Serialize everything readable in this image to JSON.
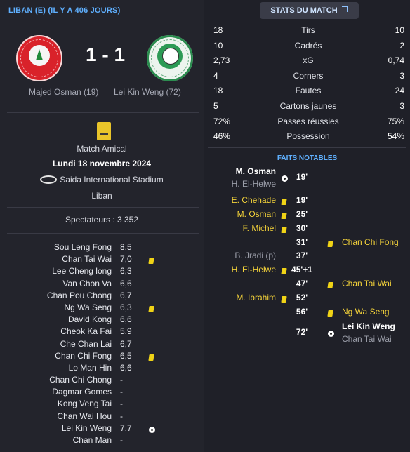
{
  "match": {
    "header": "LIBAN (E) (IL Y A 406 JOURS)",
    "score": "1 - 1",
    "home_scorer": "Majed Osman (19)",
    "away_scorer": "Lei Kin Weng (72)",
    "competition": "Match Amical",
    "date": "Lundi 18 novembre 2024",
    "stadium": "Saida International Stadium",
    "country": "Liban",
    "spectators": "Spectateurs : 3 352",
    "home_crest_text": "LEBANON F.A",
    "away_crest_icon": "football-association-crest",
    "competition_icon": "fifa-badge",
    "stadium_icon": "stadium-icon"
  },
  "players": [
    {
      "name": "Sou Leng Fong",
      "rating": "8,5",
      "icon": ""
    },
    {
      "name": "Chan Tai Wai",
      "rating": "7,0",
      "icon": "yellow-card"
    },
    {
      "name": "Lee Cheng long",
      "rating": "6,3",
      "icon": ""
    },
    {
      "name": "Van Chon Va",
      "rating": "6,6",
      "icon": ""
    },
    {
      "name": "Chan Pou Chong",
      "rating": "6,7",
      "icon": ""
    },
    {
      "name": "Ng Wa Seng",
      "rating": "6,3",
      "icon": "yellow-card"
    },
    {
      "name": "David Kong",
      "rating": "6,6",
      "icon": ""
    },
    {
      "name": "Cheok Ka Fai",
      "rating": "5,9",
      "icon": ""
    },
    {
      "name": "Che Chan Lai",
      "rating": "6,7",
      "icon": ""
    },
    {
      "name": "Chan Chi Fong",
      "rating": "6,5",
      "icon": "yellow-card"
    },
    {
      "name": "Lo Man Hin",
      "rating": "6,6",
      "icon": ""
    },
    {
      "name": "Chan Chi Chong",
      "rating": "-",
      "icon": ""
    },
    {
      "name": "Dagmar Gomes",
      "rating": "-",
      "icon": ""
    },
    {
      "name": "Kong Veng Tai",
      "rating": "-",
      "icon": ""
    },
    {
      "name": "Chan Wai Hou",
      "rating": "-",
      "icon": ""
    },
    {
      "name": "Lei Kin Weng",
      "rating": "7,7",
      "icon": "goal-ball"
    },
    {
      "name": "Chan Man",
      "rating": "-",
      "icon": ""
    }
  ],
  "stats": {
    "button_label": "STATS DU MATCH",
    "rows": [
      {
        "home": "18",
        "label": "Tirs",
        "away": "10"
      },
      {
        "home": "10",
        "label": "Cadrés",
        "away": "2"
      },
      {
        "home": "2,73",
        "label": "xG",
        "away": "0,74"
      },
      {
        "home": "4",
        "label": "Corners",
        "away": "3"
      },
      {
        "home": "18",
        "label": "Fautes",
        "away": "24"
      },
      {
        "home": "5",
        "label": "Cartons jaunes",
        "away": "3"
      },
      {
        "home": "72%",
        "label": "Passes réussies",
        "away": "75%"
      },
      {
        "home": "46%",
        "label": "Possession",
        "away": "54%"
      }
    ]
  },
  "events": {
    "title": "FAITS NOTABLES",
    "items": [
      {
        "side": "home",
        "primary": "M. Osman",
        "secondary": "H. El-Helwe",
        "minute": "19'",
        "icon": "goal-ball"
      },
      {
        "side": "home",
        "primary": "E. Chehade",
        "secondary": "",
        "minute": "19'",
        "icon": "yellow-card"
      },
      {
        "side": "home",
        "primary": "M. Osman",
        "secondary": "",
        "minute": "25'",
        "icon": "yellow-card"
      },
      {
        "side": "home",
        "primary": "F. Michel",
        "secondary": "",
        "minute": "30'",
        "icon": "yellow-card"
      },
      {
        "side": "away",
        "primary": "Chan Chi Fong",
        "secondary": "",
        "minute": "31'",
        "icon": "yellow-card"
      },
      {
        "side": "home",
        "primary": "B. Jradi (p)",
        "secondary": "",
        "minute": "37'",
        "icon": "penalty-miss"
      },
      {
        "side": "home",
        "primary": "H. El-Helwe",
        "secondary": "",
        "minute": "45'+1",
        "icon": "yellow-card"
      },
      {
        "side": "away",
        "primary": "Chan Tai Wai",
        "secondary": "",
        "minute": "47'",
        "icon": "yellow-card"
      },
      {
        "side": "home",
        "primary": "M. Ibrahim",
        "secondary": "",
        "minute": "52'",
        "icon": "yellow-card"
      },
      {
        "side": "away",
        "primary": "Ng Wa Seng",
        "secondary": "",
        "minute": "56'",
        "icon": "yellow-card"
      },
      {
        "side": "away",
        "primary": "Lei Kin Weng",
        "secondary": "Chan Tai Wai",
        "minute": "72'",
        "icon": "goal-ball"
      }
    ]
  },
  "colors": {
    "accent": "#5fb0ff",
    "yellow": "#f0d316",
    "background": "#22232b"
  }
}
